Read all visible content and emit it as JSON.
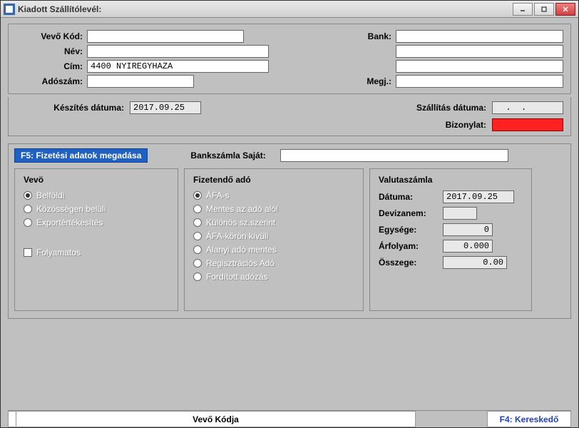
{
  "window": {
    "title": "Kiadott Szállítólevél:"
  },
  "top": {
    "vevo_kod_label": "Vevő  Kód:",
    "vevo_kod": "",
    "nev_label": "Név:",
    "nev": "",
    "cim_label": "Cím:",
    "cim": "4400 NYIREGYHAZA",
    "adoszam_label": "Adószám:",
    "adoszam": "",
    "bank_label": "Bank:",
    "bank": "",
    "bank2": "",
    "bank3": "",
    "megj_label": "Megj.:",
    "megj": ""
  },
  "dates": {
    "keszites_label": "Készítés dátuma:",
    "keszites": "2017.09.25",
    "szallitas_label": "Szállítás dátuma:",
    "szallitas": "  .  .  ",
    "bizonylat_label": "Bizonylat:",
    "bizonylat": ""
  },
  "f5": {
    "button": "F5: Fizetési adatok megadása",
    "bank_label": "Bankszámla Saját:",
    "bank": ""
  },
  "vevo": {
    "legend": "Vevö",
    "options": [
      "Belföldi",
      "Közösségen belüli",
      "Exportértékesítés"
    ],
    "selected": 0,
    "folyamatos_label": "Folyamatos"
  },
  "ado": {
    "legend": "Fizetendő adó",
    "options": [
      "ÁFA-s",
      "Mentes az adó alól",
      "Különös sz.szerint",
      "ÁFA-körön kívüli",
      "Alanyi adó mentes",
      "Regisztrációs Adó",
      "Fordított adózás"
    ],
    "selected": 0
  },
  "valuta": {
    "legend": "Valutaszámla",
    "datum_label": "Dátuma:",
    "datum": "2017.09.25",
    "devizanem_label": "Devizanem:",
    "devizanem": "",
    "egysege_label": "Egysége:",
    "egysege": "0",
    "arfolyam_label": "Árfolyam:",
    "arfolyam": "0.000",
    "osszege_label": "Összege:",
    "osszege": "0.00"
  },
  "status": {
    "mid": "Vevő Kódja",
    "right": "F4: Kereskedő"
  }
}
